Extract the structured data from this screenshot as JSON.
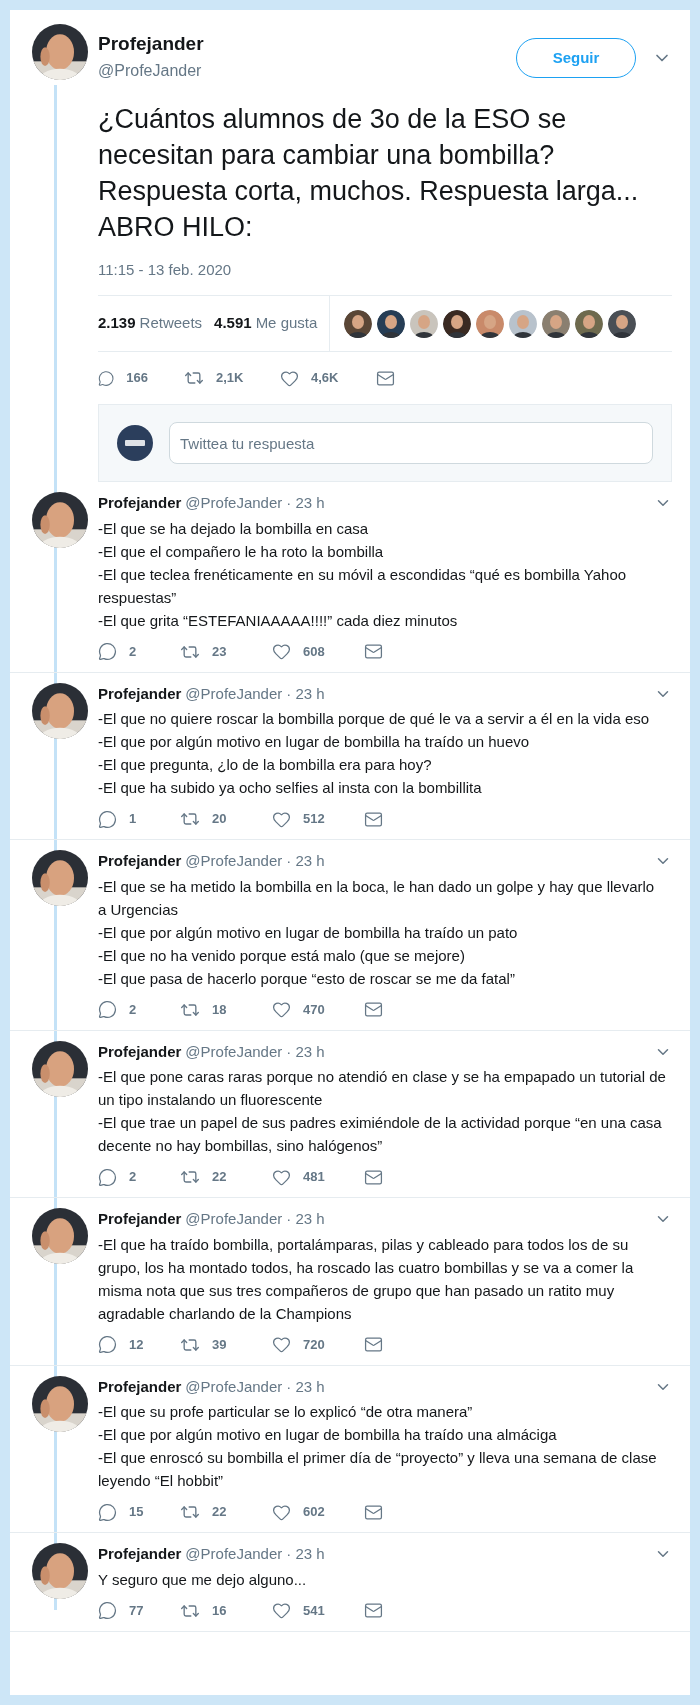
{
  "tweet": {
    "author": {
      "name": "Profejander",
      "handle": "@ProfeJander"
    },
    "follow_button": "Seguir",
    "text": "¿Cuántos alumnos de 3o de la ESO se necesitan para cambiar una bombilla? Respuesta corta, muchos. Respuesta larga... ABRO HILO:",
    "timestamp": "11:15 - 13 feb. 2020",
    "stats": {
      "retweets_count": "2.139",
      "retweets_label": "Retweets",
      "likes_count": "4.591",
      "likes_label": "Me gusta"
    },
    "actions": {
      "replies": "166",
      "retweets": "2,1K",
      "likes": "4,6K"
    },
    "reply_box": {
      "placeholder": "Twittea tu respuesta"
    }
  },
  "replies": [
    {
      "name": "Profejander",
      "handle": "@ProfeJander",
      "time": "· 23 h",
      "lines": [
        "-El que se ha dejado la bombilla en casa",
        "-El que el compañero le ha roto la bombilla",
        "-El que teclea frenéticamente en su móvil a escondidas “qué es bombilla Yahoo respuestas”",
        "-El que grita “ESTEFANIAAAAA!!!!” cada diez minutos"
      ],
      "replies": "2",
      "retweets": "23",
      "likes": "608"
    },
    {
      "name": "Profejander",
      "handle": "@ProfeJander",
      "time": "· 23 h",
      "lines": [
        "-El que no quiere roscar la bombilla porque de qué le va a servir a él en la vida eso",
        "-El que por algún motivo en lugar de bombilla ha traído un huevo",
        "-El que pregunta, ¿lo de la bombilla era para hoy?",
        "-El que ha subido ya ocho selfies al insta con la bombillita"
      ],
      "replies": "1",
      "retweets": "20",
      "likes": "512"
    },
    {
      "name": "Profejander",
      "handle": "@ProfeJander",
      "time": "· 23 h",
      "lines": [
        "-El que se ha metido la bombilla en la boca, le han dado un golpe y hay que llevarlo a Urgencias",
        "-El que por algún motivo en lugar de bombilla ha traído un pato",
        "-El que no ha venido porque está malo (que se mejore)",
        "-El que pasa de hacerlo porque “esto de roscar se me da fatal”"
      ],
      "replies": "2",
      "retweets": "18",
      "likes": "470"
    },
    {
      "name": "Profejander",
      "handle": "@ProfeJander",
      "time": "· 23 h",
      "lines": [
        "-El que pone caras raras porque no atendió en clase y se  ha empapado un tutorial de un tipo instalando un fluorescente",
        "-El que trae un papel de sus padres eximiéndole de la actividad porque “en una casa decente no hay bombillas, sino halógenos”"
      ],
      "replies": "2",
      "retweets": "22",
      "likes": "481"
    },
    {
      "name": "Profejander",
      "handle": "@ProfeJander",
      "time": "· 23 h",
      "lines": [
        "-El que ha traído bombilla, portalámparas, pilas y cableado para todos los de su grupo, los ha montado todos, ha roscado las cuatro bombillas y se va a comer la misma nota que sus tres compañeros de grupo que han pasado un ratito muy agradable charlando de la Champions"
      ],
      "replies": "12",
      "retweets": "39",
      "likes": "720"
    },
    {
      "name": "Profejander",
      "handle": "@ProfeJander",
      "time": "· 23 h",
      "lines": [
        "-El que su profe particular se lo explicó “de otra manera”",
        "-El que por algún motivo en lugar de bombilla ha traído una almáciga",
        "-El que enroscó su bombilla el primer día de “proyecto” y lleva una semana de clase leyendo “El hobbit”"
      ],
      "replies": "15",
      "retweets": "22",
      "likes": "602"
    },
    {
      "name": "Profejander",
      "handle": "@ProfeJander",
      "time": "· 23 h",
      "lines": [
        "Y seguro que me dejo alguno..."
      ],
      "replies": "77",
      "retweets": "16",
      "likes": "541"
    }
  ]
}
